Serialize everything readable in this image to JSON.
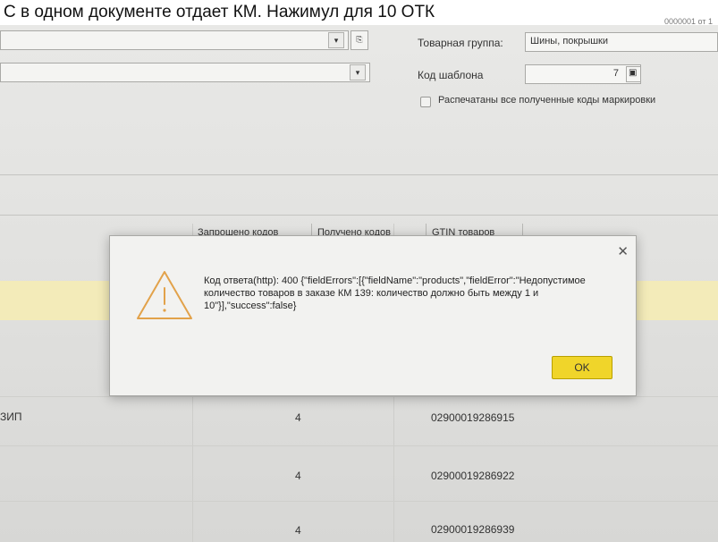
{
  "caption": {
    "text": "С в одном документе отдает КМ. Нажимул для 10 ОТК",
    "tail": "0000001 от 1"
  },
  "form": {
    "combo1_button_glyph": "▾",
    "combo1_link_glyph": "⎘",
    "combo2_button_glyph": "▾",
    "product_group_label": "Товарная группа:",
    "product_group_value": "Шины, покрышки",
    "template_code_label": "Код шаблона",
    "template_code_value": "7",
    "template_code_btn_glyph": "▣",
    "printed_checkbox_label": "Распечатаны все полученные коды маркировки"
  },
  "tabs": [
    {
      "label": "Запрошено кодов"
    },
    {
      "label": "Получено кодов"
    },
    {
      "label": "GTIN товаров"
    }
  ],
  "table": {
    "rows": [
      {
        "left": "ЗИП",
        "qty": "4",
        "code": "02900019286915"
      },
      {
        "left": "",
        "qty": "4",
        "code": "02900019286922"
      },
      {
        "left": "",
        "qty": "4",
        "code": "02900019286939"
      }
    ]
  },
  "dialog": {
    "message": "Код ответа(http): 400 {\"fieldErrors\":[{\"fieldName\":\"products\",\"fieldError\":\"Недопустимое количество товаров в заказе КМ 139: количество должно быть между 1 и 10\"}],\"success\":false}",
    "ok_label": "OK",
    "close_glyph": "✕"
  },
  "colors": {
    "ok_button": "#f0d52a",
    "highlight_row": "#f3ebb9",
    "warning_icon": "#e2a24a"
  }
}
